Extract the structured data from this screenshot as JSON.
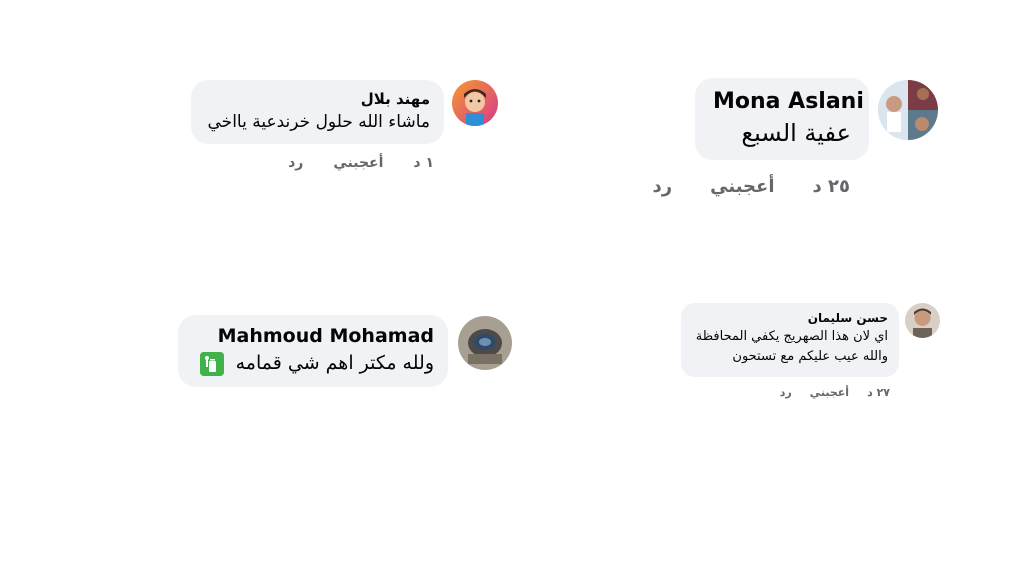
{
  "comments": [
    {
      "author": "Mona Aslani",
      "text": "عفية السبع",
      "time": "٢٥ د",
      "like_label": "أعجبني",
      "reply_label": "رد"
    },
    {
      "author": "مهند بلال",
      "text": "ماشاء الله حلول خرندعية يااخي",
      "time": "١ د",
      "like_label": "أعجبني",
      "reply_label": "رد"
    },
    {
      "author": "حسن سليمان",
      "text_lines": [
        "اي لان هذا الصهريج يكفي المحافظة",
        "والله عيب عليكم مع تستحون"
      ],
      "time": "٢٧ د",
      "like_label": "أعجبني",
      "reply_label": "رد"
    },
    {
      "author": "Mahmoud Mohamad",
      "text": "ولله مكتر اهم شي قمامه",
      "emoji": "wastebasket-emoji-icon"
    }
  ]
}
